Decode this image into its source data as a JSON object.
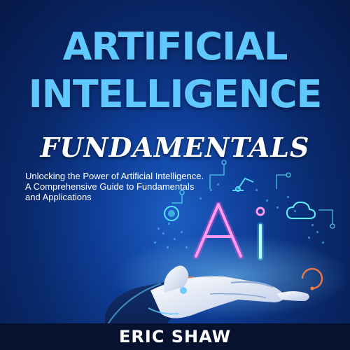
{
  "cover": {
    "title_line_1": "ARTIFICIAL",
    "title_line_2": "INTELLIGENCE",
    "subtitle": "FUNDAMENTALS",
    "tagline_lines": [
      "Unlocking the Power of Artificial Intelligence.",
      "A Comprehensive Guide to Fundamentals",
      "and Applications"
    ],
    "ai_glyph": "Ai",
    "author": "ERIC SHAW"
  },
  "colors": {
    "background_dark": "#061947",
    "background_light": "#1c5fc4",
    "title_blue": "#5ec8ff",
    "neon_pink": "#ff4fd8",
    "neon_cyan": "#5ff2ff",
    "accent_orange": "#ff7a45",
    "footer": "#07122e"
  },
  "icons": [
    "robot-arm-icon",
    "cloud-icon",
    "circuit-lines-icon",
    "chip-icon",
    "robot-hand-icon"
  ]
}
